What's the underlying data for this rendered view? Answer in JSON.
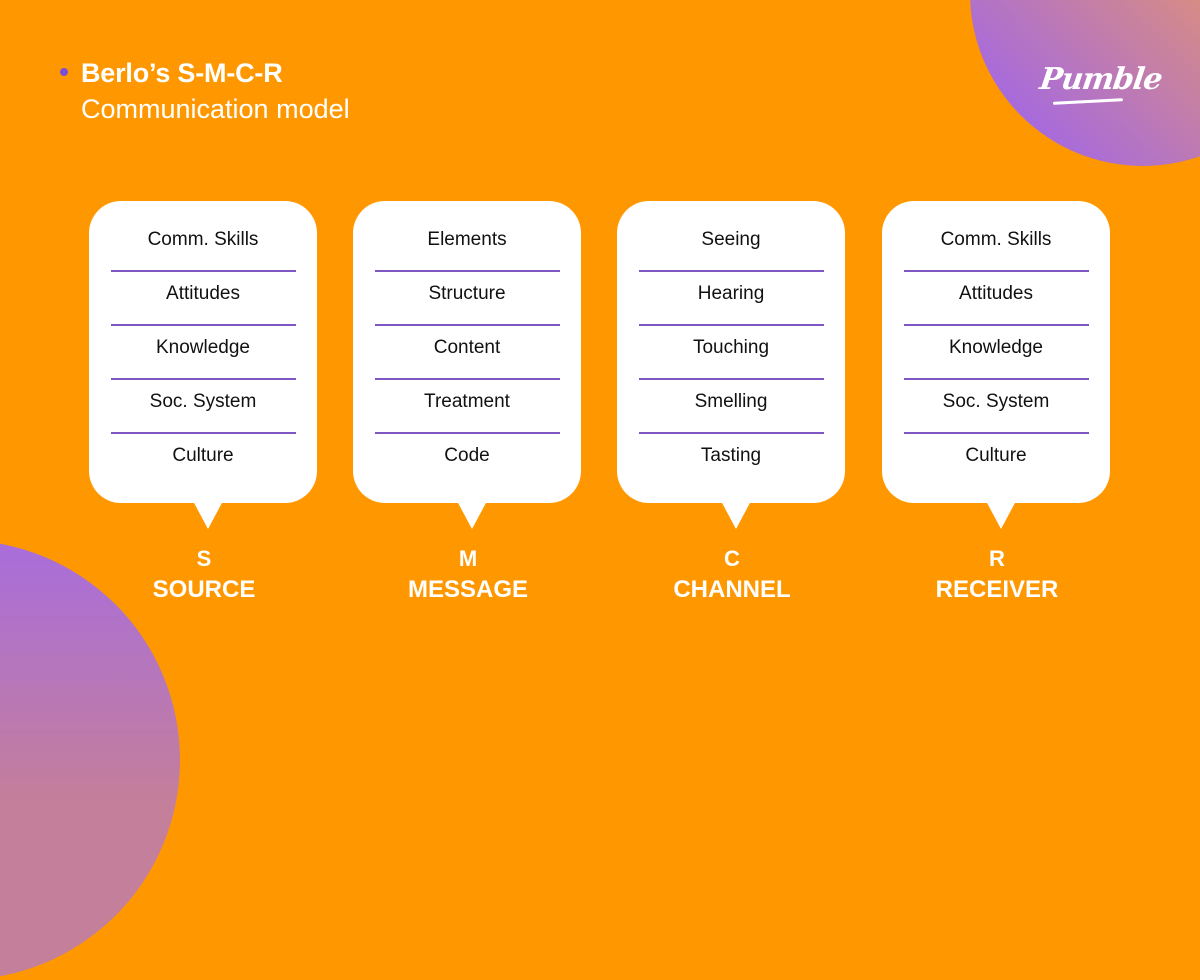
{
  "header": {
    "title_bold": "Berlo’s S-M-C-R",
    "title_sub": "Communication model",
    "logo": "Pumble"
  },
  "colors": {
    "background": "#ff9800",
    "accent": "#7e57c2",
    "card": "#ffffff",
    "text_light": "#ffffff",
    "text_dark": "#111111"
  },
  "model": [
    {
      "letter": "S",
      "name": "SOURCE",
      "items": [
        "Comm. Skills",
        "Attitudes",
        "Knowledge",
        "Soc. System",
        "Culture"
      ]
    },
    {
      "letter": "M",
      "name": "MESSAGE",
      "items": [
        "Elements",
        "Structure",
        "Content",
        "Treatment",
        "Code"
      ]
    },
    {
      "letter": "C",
      "name": "CHANNEL",
      "items": [
        "Seeing",
        "Hearing",
        "Touching",
        "Smelling",
        "Tasting"
      ]
    },
    {
      "letter": "R",
      "name": "RECEIVER",
      "items": [
        "Comm. Skills",
        "Attitudes",
        "Knowledge",
        "Soc. System",
        "Culture"
      ]
    }
  ]
}
